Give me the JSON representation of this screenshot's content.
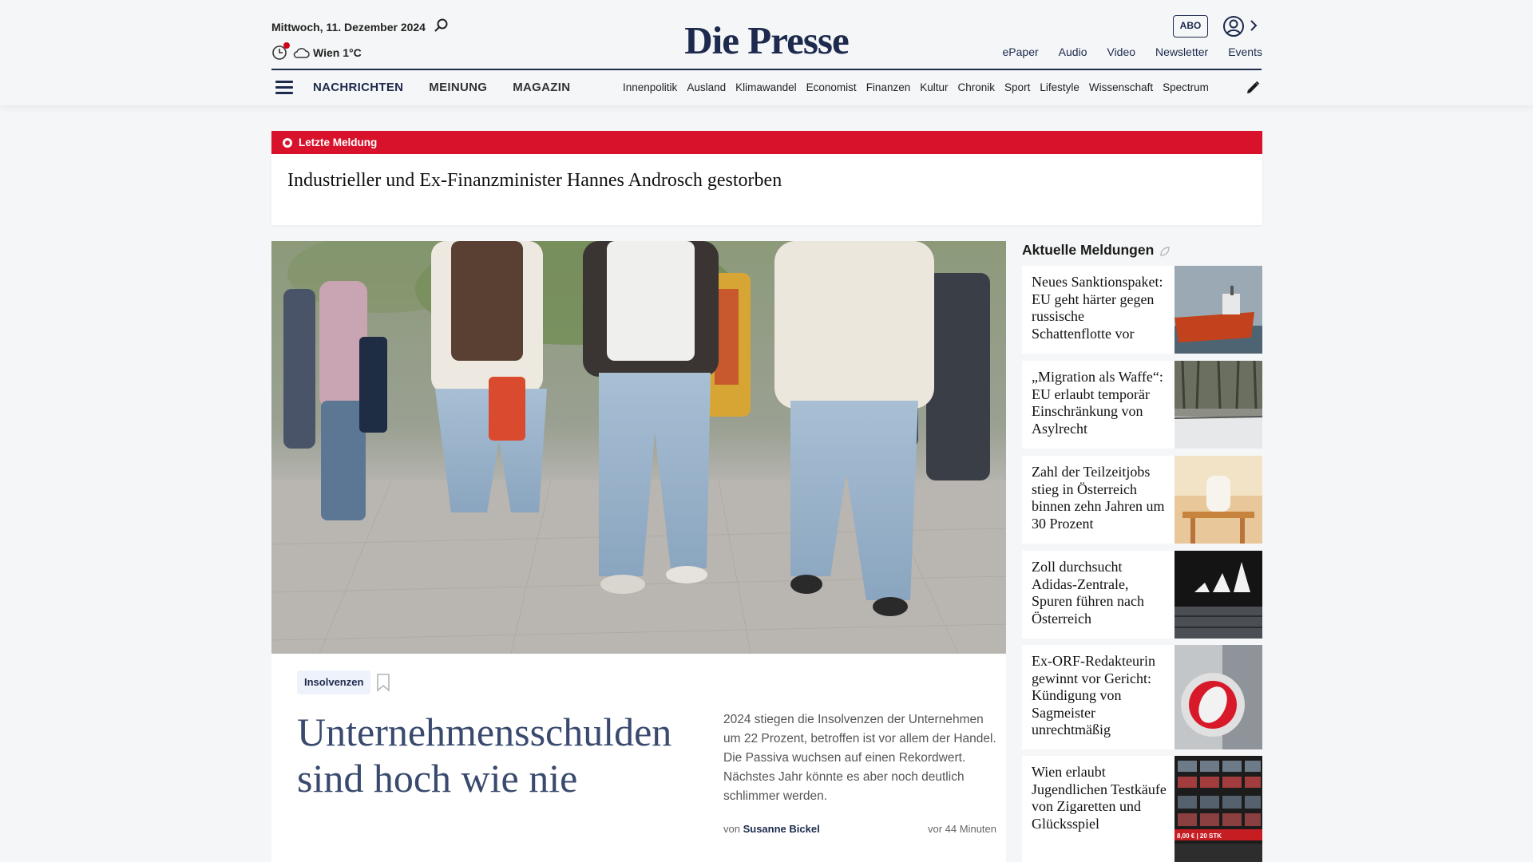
{
  "header": {
    "date": "Mittwoch, 11. Dezember 2024",
    "weather": "Wien 1°C",
    "logo": "Die Presse",
    "abo_label": "ABO",
    "top_links": [
      "ePaper",
      "Audio",
      "Video",
      "Newsletter",
      "Events"
    ]
  },
  "nav": {
    "main": [
      "NACHRICHTEN",
      "MEINUNG",
      "MAGAZIN"
    ],
    "sub": [
      "Innenpolitik",
      "Ausland",
      "Klimawandel",
      "Economist",
      "Finanzen",
      "Kultur",
      "Chronik",
      "Sport",
      "Lifestyle",
      "Wissenschaft",
      "Spectrum"
    ]
  },
  "breaking": {
    "label": "Letzte Meldung",
    "title": "Industrieller und Ex-Finanzminister Hannes Androsch gestorben"
  },
  "lead": {
    "tag": "Insolvenzen",
    "title": "Unternehmensschulden sind hoch wie nie",
    "teaser": "2024 stiegen die Insolvenzen der Unternehmen um 22 Prozent, betroffen ist vor allem der Handel. Die Passiva wuchsen auf einen Rekordwert. Nächstes Jahr könnte es aber noch deutlich schlimmer werden.",
    "byline_prefix": "von",
    "author": "Susanne Bickel",
    "time": "vor 44 Minuten"
  },
  "sidebar": {
    "heading": "Aktuelle Meldungen",
    "items": [
      {
        "title": "Neues Sanktionspa­ket: EU geht härter gegen russische Schattenflotte vor"
      },
      {
        "title": "„Migration als Waffe“: EU erlaubt temporär Einschrän­kung von Asylrecht"
      },
      {
        "title": "Zahl der Teilzeitjobs stieg in Österreich binnen zehn Jahren um 30 Prozent"
      },
      {
        "title": "Zoll durchsucht Adidas-Zentrale, Spuren führen nach Österreich"
      },
      {
        "title": "Ex-ORF-Redakteurin gewinnt vor Gericht: Kündigung von Sagmeister unrechtmäßig"
      },
      {
        "title": "Wien erlaubt Jugendlichen Testkäufe von Zigaretten und Glücksspiel"
      }
    ],
    "thumb_caption": "8,00 € | 20 STK"
  },
  "colors": {
    "brand": "#1d2a4d",
    "breaking": "#d8122b",
    "lead_title": "#394a6e"
  }
}
